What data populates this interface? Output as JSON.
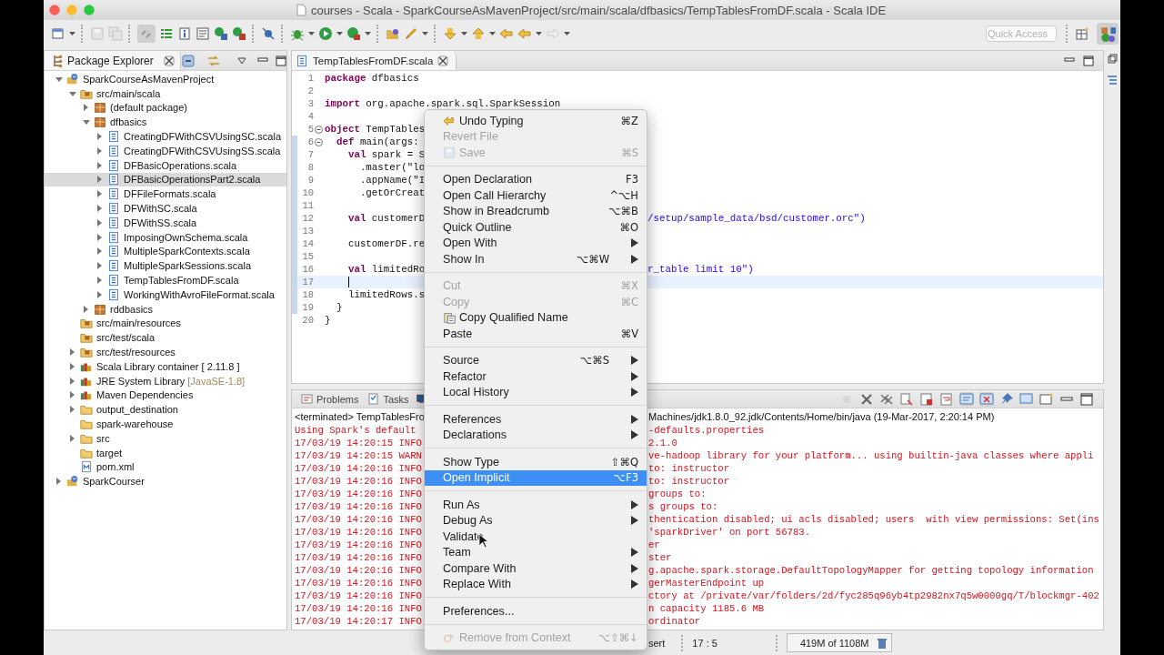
{
  "window": {
    "title": "courses - Scala - SparkCourseAsMavenProject/src/main/scala/dfbasics/TempTablesFromDF.scala - Scala IDE"
  },
  "toolbar": {
    "quick_access": {
      "placeholder": "Quick Access"
    }
  },
  "package_explorer": {
    "title": "Package Explorer",
    "tree": [
      {
        "label": "SparkCourseAsMavenProject",
        "kind": "project",
        "expanded": true,
        "selected": false,
        "children": [
          {
            "label": "src/main/scala",
            "kind": "srcfolder",
            "expanded": true,
            "selected": false,
            "children": [
              {
                "label": "(default package)",
                "kind": "package",
                "expanded": false,
                "selected": false
              },
              {
                "label": "dfbasics",
                "kind": "package",
                "expanded": true,
                "selected": false,
                "children": [
                  {
                    "label": "CreatingDFWithCSVUsingSC.scala",
                    "kind": "scala",
                    "expanded": false,
                    "selected": false
                  },
                  {
                    "label": "CreatingDFWithCSVUsingSS.scala",
                    "kind": "scala",
                    "expanded": false,
                    "selected": false
                  },
                  {
                    "label": "DFBasicOperations.scala",
                    "kind": "scala",
                    "expanded": false,
                    "selected": false
                  },
                  {
                    "label": "DFBasicOperationsPart2.scala",
                    "kind": "scala",
                    "expanded": false,
                    "selected": true
                  },
                  {
                    "label": "DFFileFormats.scala",
                    "kind": "scala",
                    "expanded": false,
                    "selected": false
                  },
                  {
                    "label": "DFWithSC.scala",
                    "kind": "scala",
                    "expanded": false,
                    "selected": false
                  },
                  {
                    "label": "DFWithSS.scala",
                    "kind": "scala",
                    "expanded": false,
                    "selected": false
                  },
                  {
                    "label": "ImposingOwnSchema.scala",
                    "kind": "scala",
                    "expanded": false,
                    "selected": false
                  },
                  {
                    "label": "MultipleSparkContexts.scala",
                    "kind": "scala",
                    "expanded": false,
                    "selected": false
                  },
                  {
                    "label": "MultipleSparkSessions.scala",
                    "kind": "scala",
                    "expanded": false,
                    "selected": false
                  },
                  {
                    "label": "TempTablesFromDF.scala",
                    "kind": "scala",
                    "expanded": false,
                    "selected": false
                  },
                  {
                    "label": "WorkingWithAvroFileFormat.scala",
                    "kind": "scala",
                    "expanded": false,
                    "selected": false
                  }
                ]
              },
              {
                "label": "rddbasics",
                "kind": "package",
                "expanded": false,
                "selected": false
              }
            ]
          },
          {
            "label": "src/main/resources",
            "kind": "srcfolder",
            "selected": false
          },
          {
            "label": "src/test/scala",
            "kind": "srcfolder",
            "selected": false
          },
          {
            "label": "src/test/resources",
            "kind": "srcfolder",
            "expanded": false,
            "selected": false
          },
          {
            "label": "Scala Library container [ 2.11.8 ]",
            "kind": "library",
            "expanded": false,
            "selected": false
          },
          {
            "label": "JRE System Library",
            "decoration": "[JavaSE-1.8]",
            "kind": "library",
            "expanded": false,
            "selected": false
          },
          {
            "label": "Maven Dependencies",
            "kind": "library",
            "expanded": false,
            "selected": false
          },
          {
            "label": "output_destination",
            "kind": "folder",
            "expanded": false,
            "selected": false
          },
          {
            "label": "spark-warehouse",
            "kind": "folder",
            "selected": false
          },
          {
            "label": "src",
            "kind": "folder",
            "expanded": false,
            "selected": false
          },
          {
            "label": "target",
            "kind": "folder",
            "selected": false
          },
          {
            "label": "pom.xml",
            "kind": "xml",
            "selected": false
          }
        ]
      },
      {
        "label": "SparkCourser",
        "kind": "project",
        "expanded": false,
        "selected": false
      }
    ]
  },
  "editor": {
    "tab": "TempTablesFromDF.scala",
    "lines": [
      {
        "number": "1",
        "code": "**package** dfbasics",
        "fold": false,
        "in_range": false,
        "current": false
      },
      {
        "number": "2",
        "fold": false,
        "in_range": false,
        "current": false
      },
      {
        "number": "3",
        "code": "**import** org.apache.spark.sql.SparkSession",
        "fold": false,
        "in_range": false,
        "current": false
      },
      {
        "number": "4",
        "fold": false,
        "in_range": false,
        "current": false
      },
      {
        "number": "5",
        "code": "**object** TempTables",
        "fold": true,
        "in_range": false,
        "current": false
      },
      {
        "number": "6",
        "code": "  **def** main(args:",
        "fold": true,
        "in_range": true,
        "current": false
      },
      {
        "number": "7",
        "code": "    **val** spark = S",
        "fold": false,
        "in_range": true,
        "current": false
      },
      {
        "number": "8",
        "code": "      .master(\"lo",
        "fold": false,
        "in_range": true,
        "current": false
      },
      {
        "number": "9",
        "code": "      .appName(\"I",
        "fold": false,
        "in_range": true,
        "current": false
      },
      {
        "number": "10",
        "code": "      .getOrCreat",
        "fold": false,
        "in_range": true,
        "current": false
      },
      {
        "number": "11",
        "fold": false,
        "in_range": true,
        "current": false
      },
      {
        "number": "12",
        "code": "    **val** customerD",
        "tail": "/setup/sample_data/bsd/customer.orc\")",
        "fold": false,
        "in_range": true,
        "current": false
      },
      {
        "number": "13",
        "fold": false,
        "in_range": true,
        "current": false
      },
      {
        "number": "14",
        "code": "    customerDF.re",
        "fold": false,
        "in_range": true,
        "current": false
      },
      {
        "number": "15",
        "fold": false,
        "in_range": true,
        "current": false
      },
      {
        "number": "16",
        "code": "    **val** limitedRo",
        "tail": "r_table limit 10\")",
        "fold": false,
        "in_range": true,
        "current": false
      },
      {
        "number": "17",
        "fold": false,
        "in_range": true,
        "current": true
      },
      {
        "number": "18",
        "code": "    limitedRows.s",
        "fold": false,
        "in_range": true,
        "current": false
      },
      {
        "number": "19",
        "code": "  }",
        "fold": false,
        "in_range": true,
        "current": false
      },
      {
        "number": "20",
        "code": "}",
        "fold": false,
        "in_range": false,
        "current": false
      }
    ]
  },
  "console": {
    "tabs": [
      {
        "label": "Problems",
        "kind": "problems",
        "selected": false
      },
      {
        "label": "Tasks",
        "kind": "tasks",
        "selected": false
      }
    ],
    "header": {
      "text": "<terminated> TempTablesFro",
      "tail": "Machines/jdk1.8.0_92.jdk/Contents/Home/bin/java (19-Mar-2017, 2:20:14 PM)"
    },
    "lines": [
      {
        "text": "Using Spark's default",
        "tail": "-defaults.properties"
      },
      {
        "text": "17/03/19 14:20:15 INFO",
        "tail": "2.1.0"
      },
      {
        "text": "17/03/19 14:20:15 WARN",
        "tail": "ve-hadoop library for your platform... using builtin-java classes where appli"
      },
      {
        "text": "17/03/19 14:20:16 INFO",
        "tail": "to: instructor"
      },
      {
        "text": "17/03/19 14:20:16 INFO",
        "tail": "to: instructor"
      },
      {
        "text": "17/03/19 14:20:16 INFO",
        "tail": "groups to:"
      },
      {
        "text": "17/03/19 14:20:16 INFO",
        "tail": "s groups to:"
      },
      {
        "text": "17/03/19 14:20:16 INFO",
        "tail": "thentication disabled; ui acls disabled; users  with view permissions: Set(ins"
      },
      {
        "text": "17/03/19 14:20:16 INFO",
        "tail": "'sparkDriver' on port 56783."
      },
      {
        "text": "17/03/19 14:20:16 INFO",
        "tail": "er"
      },
      {
        "text": "17/03/19 14:20:16 INFO",
        "tail": "ster"
      },
      {
        "text": "17/03/19 14:20:16 INFO",
        "tail": "g.apache.spark.storage.DefaultTopologyMapper for getting topology information"
      },
      {
        "text": "17/03/19 14:20:16 INFO",
        "tail": "gerMasterEndpoint up"
      },
      {
        "text": "17/03/19 14:20:16 INFO",
        "tail": "ctory at /private/var/folders/2d/fyc285q96yb4tp2982nx7q5w0000gq/T/blockmgr-402"
      },
      {
        "text": "17/03/19 14:20:16 INFO",
        "tail": "n capacity 1185.6 MB"
      },
      {
        "text": "17/03/19 14:20:17 INFO",
        "tail": "ordinator"
      }
    ]
  },
  "context_menu": {
    "groups": [
      [
        {
          "label": "Undo Typing",
          "shortcut": "⌘Z",
          "kind": "undo",
          "submenu": false,
          "disabled": false,
          "selected": false
        },
        {
          "label": "Revert File",
          "submenu": false,
          "disabled": true,
          "selected": false
        },
        {
          "label": "Save",
          "shortcut": "⌘S",
          "kind": "save",
          "submenu": false,
          "disabled": true,
          "selected": false
        }
      ],
      [
        {
          "label": "Open Declaration",
          "shortcut": "F3",
          "submenu": false,
          "disabled": false,
          "selected": false
        },
        {
          "label": "Open Call Hierarchy",
          "shortcut": "^⌥H",
          "submenu": false,
          "disabled": false,
          "selected": false
        },
        {
          "label": "Show in Breadcrumb",
          "shortcut": "⌥⌘B",
          "submenu": false,
          "disabled": false,
          "selected": false
        },
        {
          "label": "Quick Outline",
          "shortcut": "⌘O",
          "submenu": false,
          "disabled": false,
          "selected": false
        },
        {
          "label": "Open With",
          "submenu": true,
          "disabled": false,
          "selected": false
        },
        {
          "label": "Show In",
          "shortcut": "⌥⌘W",
          "submenu": true,
          "disabled": false,
          "selected": false
        }
      ],
      [
        {
          "label": "Cut",
          "shortcut": "⌘X",
          "submenu": false,
          "disabled": true,
          "selected": false
        },
        {
          "label": "Copy",
          "shortcut": "⌘C",
          "submenu": false,
          "disabled": true,
          "selected": false
        },
        {
          "label": "Copy Qualified Name",
          "kind": "clipboard",
          "submenu": false,
          "disabled": false,
          "selected": false
        },
        {
          "label": "Paste",
          "shortcut": "⌘V",
          "submenu": false,
          "disabled": false,
          "selected": false
        }
      ],
      [
        {
          "label": "Source",
          "shortcut": "⌥⌘S",
          "submenu": true,
          "disabled": false,
          "selected": false
        },
        {
          "label": "Refactor",
          "submenu": true,
          "disabled": false,
          "selected": false
        },
        {
          "label": "Local History",
          "submenu": true,
          "disabled": false,
          "selected": false
        }
      ],
      [
        {
          "label": "References",
          "submenu": true,
          "disabled": false,
          "selected": false
        },
        {
          "label": "Declarations",
          "submenu": true,
          "disabled": false,
          "selected": false
        }
      ],
      [
        {
          "label": "Show Type",
          "shortcut": "⇧⌘Q",
          "submenu": false,
          "disabled": false,
          "selected": false
        },
        {
          "label": "Open Implicit",
          "shortcut": "⌥F3",
          "submenu": false,
          "disabled": false,
          "selected": true
        }
      ],
      [
        {
          "label": "Run As",
          "submenu": true,
          "disabled": false,
          "selected": false
        },
        {
          "label": "Debug As",
          "submenu": true,
          "disabled": false,
          "selected": false
        },
        {
          "label": "Validate",
          "submenu": false,
          "disabled": false,
          "selected": false
        },
        {
          "label": "Team",
          "submenu": true,
          "disabled": false,
          "selected": false
        },
        {
          "label": "Compare With",
          "submenu": true,
          "disabled": false,
          "selected": false
        },
        {
          "label": "Replace With",
          "submenu": true,
          "disabled": false,
          "selected": false
        }
      ],
      [
        {
          "label": "Preferences...",
          "submenu": false,
          "disabled": false,
          "selected": false
        }
      ],
      [
        {
          "label": "Remove from Context",
          "shortcut": "⌥⇧⌘↓",
          "kind": "context",
          "submenu": false,
          "disabled": true,
          "selected": false
        }
      ]
    ]
  },
  "status_bar": {
    "mode": "sert",
    "position": "17 : 5",
    "heap": "419M of 1108M"
  }
}
